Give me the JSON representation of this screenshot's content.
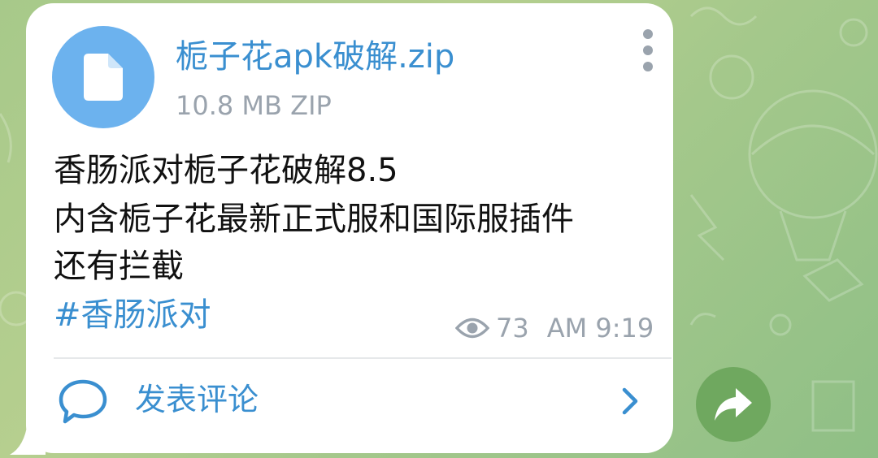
{
  "file": {
    "name": "栀子花apk破解.zip",
    "meta": "10.8 MB ZIP"
  },
  "message": {
    "lines": [
      "香肠派对栀子花破解8.5",
      "内含栀子花最新正式服和国际服插件",
      "还有拦截"
    ],
    "hashtag": "#香肠派对",
    "views": "73",
    "time": "AM 9:19"
  },
  "comments": {
    "label": "发表评论"
  },
  "icons": {
    "file": "file-icon",
    "menu": "more-vertical-icon",
    "views": "eye-icon",
    "comments": "comment-bubble-icon",
    "open": "chevron-right-icon",
    "forward": "share-forward-icon"
  },
  "colors": {
    "accent": "#3a8fd0",
    "file_circle": "#6cb2ee",
    "meta_gray": "#9aa3ad",
    "forward_button": "#6fa85f",
    "wallpaper": "#a7c98a"
  }
}
